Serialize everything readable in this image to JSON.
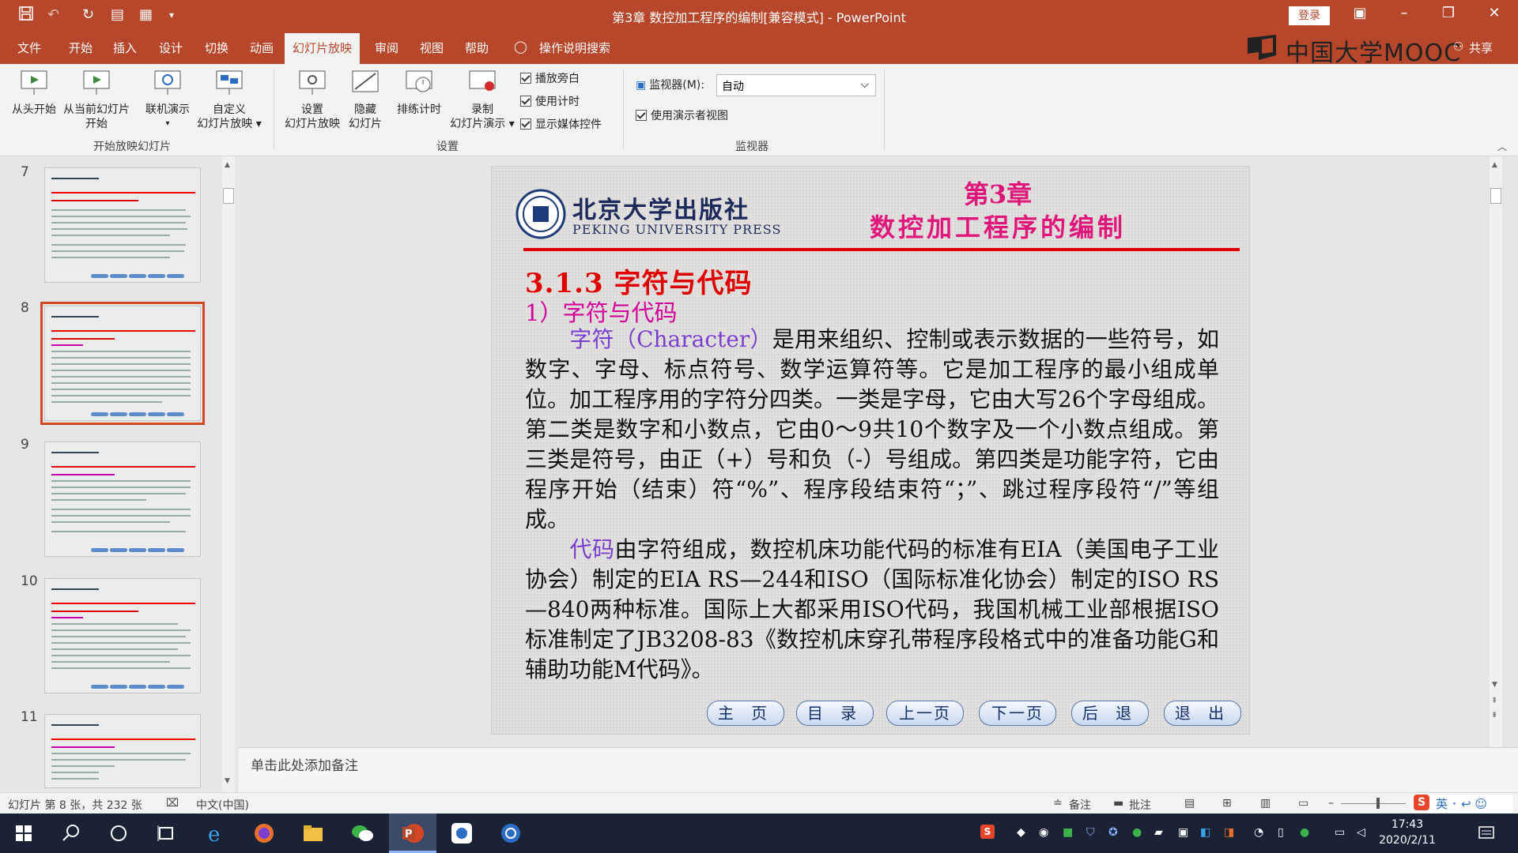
{
  "window": {
    "title": "第3章 数控加工程序的编制[兼容模式] - PowerPoint",
    "login": "登录"
  },
  "menu": {
    "tabs": [
      "文件",
      "开始",
      "插入",
      "设计",
      "切换",
      "动画",
      "幻灯片放映",
      "审阅",
      "视图",
      "帮助"
    ],
    "tell_me": "操作说明搜索",
    "share": "共享",
    "brand": "中国大学MOOC"
  },
  "ribbon": {
    "buttons": {
      "from_start": "从头开始",
      "from_current_1": "从当前幻灯片",
      "from_current_2": "开始",
      "online": "联机演示",
      "custom_1": "自定义",
      "custom_2": "幻灯片放映",
      "setup_1": "设置",
      "setup_2": "幻灯片放映",
      "hide_1": "隐藏",
      "hide_2": "幻灯片",
      "rehearse": "排练计时",
      "record_1": "录制",
      "record_2": "幻灯片演示"
    },
    "checkboxes": {
      "narration": "播放旁白",
      "timings": "使用计时",
      "media": "显示媒体控件",
      "presenter": "使用演示者视图"
    },
    "monitor_label": "监视器(M):",
    "monitor_value": "自动",
    "groups": {
      "start": "开始放映幻灯片",
      "setup": "设置",
      "monitors": "监视器"
    }
  },
  "thumbnails": {
    "numbers": [
      "7",
      "8",
      "9",
      "10",
      "11"
    ],
    "selected": "8"
  },
  "slide": {
    "publisher_cn": "北京大学出版社",
    "publisher_en": "PEKING UNIVERSITY PRESS",
    "chapter": "第3章",
    "chapter_title": "数控加工程序的编制",
    "heading": "3.1.3 字符与代码",
    "subheading": "1）字符与代码",
    "p1_kw": "字符（Character）",
    "p1": "是用来组织、控制或表示数据的一些符号，如数字、字母、标点符号、数学运算符等。它是加工程序的最小组成单位。加工程序用的字符分四类。一类是字母，它由大写26个字母组成。第二类是数字和小数点，它由0～9共10个数字及一个小数点组成。第三类是符号，由正（+）号和负（-）号组成。第四类是功能字符，它由程序开始（结束）符“%”、程序段结束符“；”、跳过程序段符“/”等组成。",
    "p2_kw": "代码",
    "p2": "由字符组成，数控机床功能代码的标准有EIA（美国电子工业协会）制定的EIA RS—244和ISO（国际标准化协会）制定的ISO RS—840两种标准。国际上大都采用ISO代码，我国机械工业部根据ISO标准制定了JB3208-83《数控机床穿孔带程序段格式中的准备功能G和辅助功能M代码》。",
    "nav": [
      "主 页",
      "目 录",
      "上一页",
      "下一页",
      "后 退",
      "退 出"
    ]
  },
  "notes": {
    "placeholder": "单击此处添加备注"
  },
  "status": {
    "slide_info": "幻灯片 第 8 张，共 232 张",
    "language": "中文(中国)",
    "notes_btn": "备注",
    "comments_btn": "批注"
  },
  "taskbar": {
    "time": "17:43",
    "date": "2020/2/11"
  },
  "colors": {
    "accent": "#b7472a",
    "slide_red": "#e00000",
    "slide_magenta": "#e0167a"
  }
}
